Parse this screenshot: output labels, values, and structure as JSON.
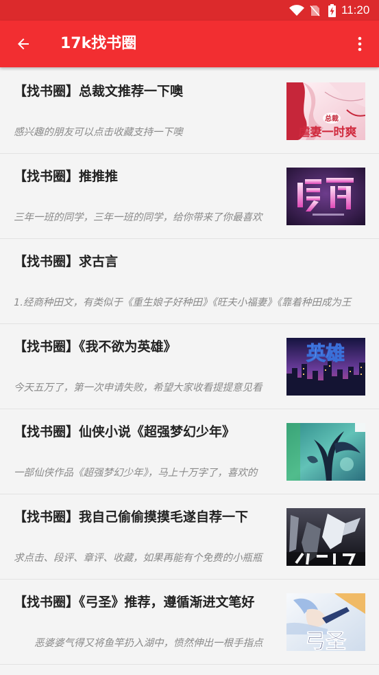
{
  "status_bar": {
    "time": "11:20",
    "icons": {
      "wifi": "wifi-icon",
      "sim": "no-sim-icon",
      "battery": "battery-charging-icon"
    }
  },
  "app_bar": {
    "title": "17k找书圈",
    "back_icon": "arrow-back-icon",
    "menu_icon": "more-vert-icon"
  },
  "theme": {
    "status_bar_color": "#dc2a2c",
    "app_bar_color": "#f22e31",
    "background_color": "#f4f4f4",
    "title_color": "#222222",
    "summary_color": "#8a8a8a",
    "divider_color": "#e2e2e2"
  },
  "posts": [
    {
      "title": "【找书圈】总裁文推荐一下噢",
      "summary": "感兴趣的朋友可以点击收藏支持一下噢",
      "cover_lettering": [
        "总裁",
        "虐妻一时爽"
      ]
    },
    {
      "title": "【找书圈】推推推",
      "summary": "三年一班的同学，三年一班的同学，给你带来了你最喜欢"
    },
    {
      "title": "【找书圈】求古言",
      "summary": "1.经商种田文，有类似于《重生娘子好种田》《旺夫小福妻》《靠着种田成为王"
    },
    {
      "title": "【找书圈】《我不欲为英雄》",
      "summary": "今天五万了，第一次申请失败，希望大家收看提提意见看",
      "cover_lettering": [
        "英雄"
      ]
    },
    {
      "title": "【找书圈】仙侠小说《超强梦幻少年》",
      "summary": "一部仙侠作品《超强梦幻少年》，马上十万字了，喜欢的"
    },
    {
      "title": "【找书圈】我自己偷偷摸摸毛遂自荐一下",
      "summary": "求点击、段评、章评、收藏，如果再能有个免费的小瓶瓶"
    },
    {
      "title": "【找书圈】《弓圣》推荐，遵循渐进文笔好",
      "summary": "恶婆婆气得又将鱼竿扔入湖中，愤然伸出一根手指点",
      "cover_lettering": [
        "弓圣"
      ]
    }
  ]
}
